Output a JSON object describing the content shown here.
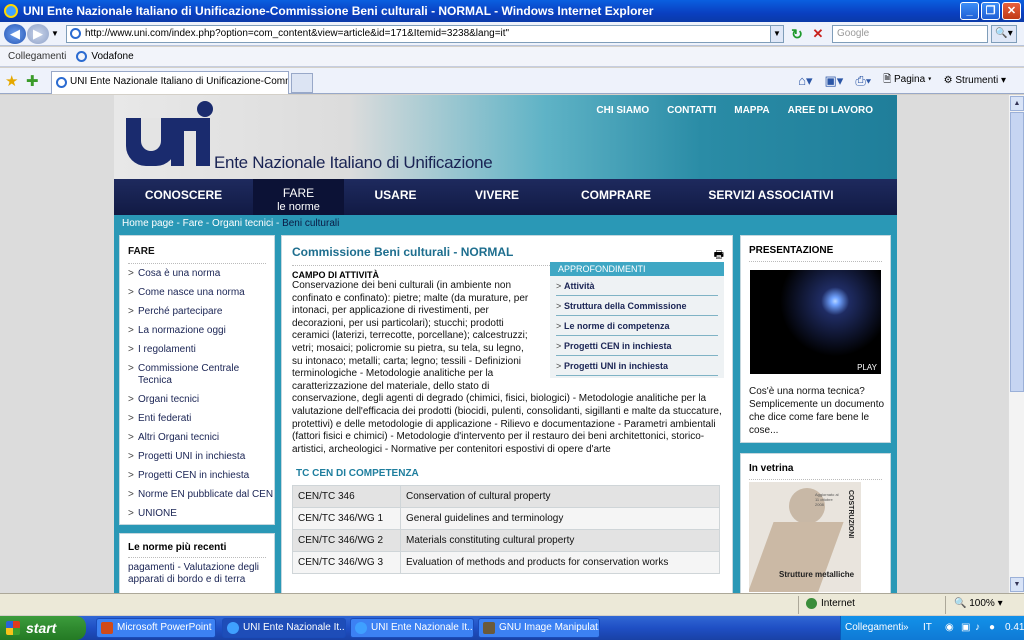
{
  "window": {
    "title": "UNI Ente Nazionale Italiano di Unificazione-Commissione Beni culturali - NORMAL - Windows Internet Explorer"
  },
  "address": {
    "url": "http://www.uni.com/index.php?option=com_content&view=article&id=171&Itemid=3238&lang=it\"",
    "search_placeholder": "Google"
  },
  "links_bar": {
    "label": "Collegamenti",
    "item": "Vodafone"
  },
  "tab": {
    "label": "UNI Ente Nazionale Italiano di Unificazione-Commissio..."
  },
  "toolbar": {
    "page_label": "Pagina",
    "tools_label": "Strumenti"
  },
  "site": {
    "name": "Ente Nazionale Italiano di Unificazione",
    "top_nav": [
      "CHI SIAMO",
      "CONTATTI",
      "MAPPA",
      "AREE DI LAVORO"
    ],
    "main_nav": [
      {
        "label": "CONOSCERE"
      },
      {
        "label": "FARE",
        "sub": "le norme"
      },
      {
        "label": "USARE"
      },
      {
        "label": "VIVERE"
      },
      {
        "label": "COMPRARE"
      },
      {
        "label": "SERVIZI ASSOCIATIVI"
      }
    ],
    "breadcrumb": [
      "Home page",
      "Fare",
      "Organi tecnici",
      "Beni culturali"
    ],
    "breadcrumb_sep": " - ",
    "left": {
      "title": "FARE",
      "items": [
        "Cosa è una norma",
        "Come nasce una norma",
        "Perché partecipare",
        "La normazione oggi",
        "I regolamenti",
        "Commissione Centrale Tecnica",
        "Organi tecnici",
        "Enti federati",
        "Altri Organi tecnici",
        "Progetti UNI in inchiesta",
        "Progetti CEN in inchiesta",
        "Norme EN pubblicate dal CEN",
        "UNIONE"
      ],
      "recent_title": "Le norme più recenti",
      "recent_text": "pagamenti - Valutazione degli apparati di bordo e di terra"
    },
    "center": {
      "title": "Commissione Beni culturali - NORMAL",
      "section": "CAMPO DI ATTIVITÀ",
      "body_part1": "Conservazione dei beni culturali (in ambiente non confinato e confinato): pietre; malte (da murature, per intonaci, per applicazione di rivestimenti, per decorazioni, per usi particolari); stucchi; prodotti ceramici (laterizi, terrecotte, porcellane); calcestruzzi; vetri; mosaici; policromie su pietra, su tela, su legno, su intonaco; metalli; carta; legno; tessili - Definizioni terminologiche - Metodologie analitiche per la caratterizzazione del materiale, dello stato di",
      "body_part2": "conservazione, degli agenti di degrado (chimici, fisici, biologici) - Metodologie analitiche per la valutazione dell'efficacia dei prodotti (biocidi, pulenti, consolidanti, sigillanti e malte da stuccature, protettivi) e delle metodologie di applicazione - Rilievo e documentazione - Parametri ambientali (fattori fisici e chimici) - Metodologie d'intervento per il restauro dei beni architettonici, storico-artistici, archeologici - Normative per contenitori espostivi di opere d'arte",
      "approfondimenti_title": "APPROFONDIMENTI",
      "approfondimenti": [
        "Attività",
        "Struttura della Commissione",
        "Le norme di competenza",
        "Progetti CEN in inchiesta",
        "Progetti UNI in inchiesta"
      ],
      "tc_title": "TC CEN DI COMPETENZA",
      "tc_rows": [
        {
          "code": "CEN/TC 346",
          "desc": "Conservation of cultural property"
        },
        {
          "code": "CEN/TC 346/WG 1",
          "desc": "General guidelines and terminology"
        },
        {
          "code": "CEN/TC 346/WG 2",
          "desc": "Materials constituting cultural property"
        },
        {
          "code": "CEN/TC 346/WG 3",
          "desc": "Evaluation of methods and products for conservation works"
        }
      ]
    },
    "right": {
      "presentazione_title": "PRESENTAZIONE",
      "play_label": "PLAY",
      "desc": "Cos'è una norma tecnica? Semplicemente un documento che dice come fare bene le cose...",
      "vetrina_title": "In vetrina",
      "book_label": "Strutture metalliche",
      "book_spine": "COSTRUZIONI",
      "book_small": "Aggiornato al 11 ottobre 2008"
    }
  },
  "status": {
    "zone": "Internet",
    "zoom": "100%"
  },
  "taskbar": {
    "start": "start",
    "items": [
      "Microsoft PowerPoint ...",
      "UNI Ente Nazionale It...",
      "UNI Ente Nazionale It...",
      "GNU Image Manipulat..."
    ],
    "tray_links": "Collegamenti",
    "lang": "IT",
    "clock": "0.41"
  }
}
